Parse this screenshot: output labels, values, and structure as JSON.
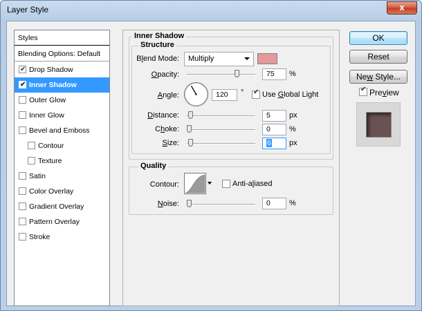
{
  "window": {
    "title": "Layer Style",
    "close_glyph": "x"
  },
  "styles_list": {
    "header": "Styles",
    "blending_options": "Blending Options: Default",
    "items": [
      {
        "label": "Drop Shadow",
        "checked": true,
        "selected": false,
        "sub": false
      },
      {
        "label": "Inner Shadow",
        "checked": true,
        "selected": true,
        "sub": false
      },
      {
        "label": "Outer Glow",
        "checked": false,
        "selected": false,
        "sub": false
      },
      {
        "label": "Inner Glow",
        "checked": false,
        "selected": false,
        "sub": false
      },
      {
        "label": "Bevel and Emboss",
        "checked": false,
        "selected": false,
        "sub": false
      },
      {
        "label": "Contour",
        "checked": false,
        "selected": false,
        "sub": true
      },
      {
        "label": "Texture",
        "checked": false,
        "selected": false,
        "sub": true
      },
      {
        "label": "Satin",
        "checked": false,
        "selected": false,
        "sub": false
      },
      {
        "label": "Color Overlay",
        "checked": false,
        "selected": false,
        "sub": false
      },
      {
        "label": "Gradient Overlay",
        "checked": false,
        "selected": false,
        "sub": false
      },
      {
        "label": "Pattern Overlay",
        "checked": false,
        "selected": false,
        "sub": false
      },
      {
        "label": "Stroke",
        "checked": false,
        "selected": false,
        "sub": false
      }
    ]
  },
  "inner_shadow": {
    "title": "Inner Shadow",
    "structure": {
      "title": "Structure",
      "blend_mode_label_pre": "B",
      "blend_mode_label_u": "l",
      "blend_mode_label_post": "end Mode:",
      "blend_mode_value": "Multiply",
      "shadow_color": "#e49a9a",
      "opacity_label_u": "O",
      "opacity_label_post": "pacity:",
      "opacity_value": "75",
      "opacity_percent": 75,
      "percent_unit": "%",
      "angle_label_u": "A",
      "angle_label_post": "ngle:",
      "angle_value": "120",
      "angle_degrees": 120,
      "degree_unit": "°",
      "use_global_light_pre": "Use ",
      "use_global_light_u": "G",
      "use_global_light_post": "lobal Light",
      "use_global_light_checked": true,
      "distance_label_u": "D",
      "distance_label_post": "istance:",
      "distance_value": "5",
      "distance_fraction": 0.02,
      "choke_label_pre": "C",
      "choke_label_u": "h",
      "choke_label_post": "oke:",
      "choke_value": "0",
      "choke_percent": 0,
      "size_label_u": "S",
      "size_label_post": "ize:",
      "size_value": "6",
      "size_fraction": 0.02,
      "px_unit": "px"
    },
    "quality": {
      "title": "Quality",
      "contour_label": "Contour:",
      "anti_aliased_pre": "Anti-a",
      "anti_aliased_u": "l",
      "anti_aliased_post": "iased",
      "anti_aliased_checked": false,
      "noise_label_u": "N",
      "noise_label_post": "oise:",
      "noise_value": "0",
      "noise_percent": 0,
      "percent_unit": "%"
    }
  },
  "buttons": {
    "ok": "OK",
    "reset": "Reset",
    "new_style_pre": "Ne",
    "new_style_u": "w",
    "new_style_post": " Style...",
    "preview_pre": "Pre",
    "preview_u": "v",
    "preview_post": "iew",
    "preview_checked": true
  }
}
